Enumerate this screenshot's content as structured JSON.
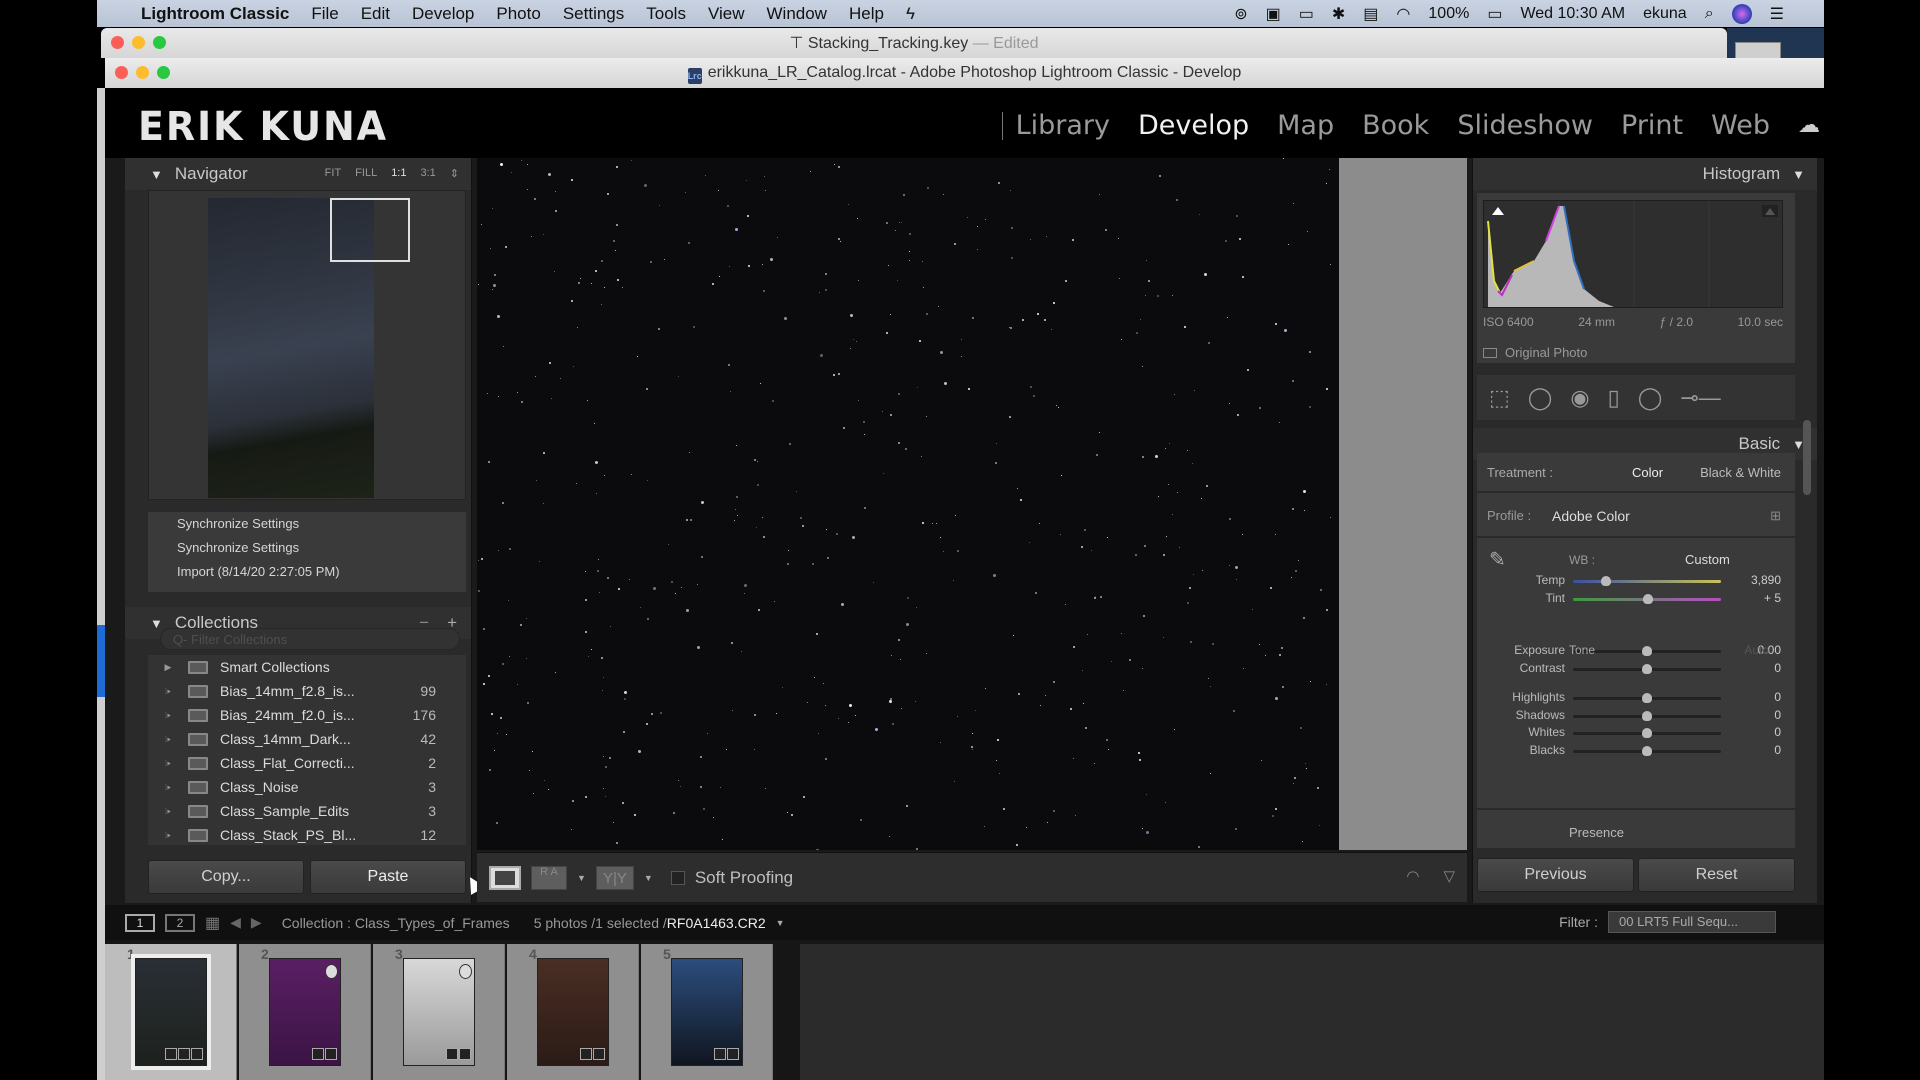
{
  "mac_menubar": {
    "app_name": "Lightroom Classic",
    "menus": [
      "File",
      "Edit",
      "Develop",
      "Photo",
      "Settings",
      "Tools",
      "View",
      "Window",
      "Help"
    ],
    "battery": "100%",
    "clock": "Wed 10:30 AM",
    "user": "ekuna"
  },
  "keynote_window": {
    "title": "Stacking_Tracking.key",
    "edited": "— Edited"
  },
  "lr_window": {
    "title": "erikkuna_LR_Catalog.lrcat - Adobe Photoshop Lightroom Classic - Develop",
    "icon_text": "Lrc"
  },
  "identity_plate": "ERIK KUNA",
  "modules": {
    "items": [
      "Library",
      "Develop",
      "Map",
      "Book",
      "Slideshow",
      "Print",
      "Web"
    ],
    "active": "Develop"
  },
  "navigator": {
    "title": "Navigator",
    "zoom_options": [
      "FIT",
      "FILL",
      "1:1",
      "3:1"
    ],
    "selected_zoom": "1:1"
  },
  "history": {
    "items": [
      "Synchronize Settings",
      "Synchronize Settings",
      "Import (8/14/20 2:27:05 PM)"
    ]
  },
  "collections": {
    "title": "Collections",
    "minus": "−",
    "plus": "+",
    "filter_placeholder": "Q- Filter Collections",
    "items": [
      {
        "name": "Smart Collections",
        "count": ""
      },
      {
        "name": "Bias_14mm_f2.8_is...",
        "count": "99"
      },
      {
        "name": "Bias_24mm_f2.0_is...",
        "count": "176"
      },
      {
        "name": "Class_14mm_Dark...",
        "count": "42"
      },
      {
        "name": "Class_Flat_Correcti...",
        "count": "2"
      },
      {
        "name": "Class_Noise",
        "count": "3"
      },
      {
        "name": "Class_Sample_Edits",
        "count": "3"
      },
      {
        "name": "Class_Stack_PS_Bl...",
        "count": "12"
      }
    ]
  },
  "left_buttons": {
    "copy": "Copy...",
    "paste": "Paste"
  },
  "toolbar": {
    "soft_proofing": "Soft Proofing",
    "before_after_label": "R A",
    "yy_label": "Y|Y"
  },
  "histogram": {
    "title": "Histogram",
    "iso": "ISO 6400",
    "focal": "24 mm",
    "aperture": "ƒ / 2.0",
    "shutter": "10.0 sec",
    "original_photo": "Original Photo"
  },
  "basic": {
    "title": "Basic",
    "treatment_label": "Treatment :",
    "treatment_options": [
      "Color",
      "Black & White"
    ],
    "treatment_selected": "Color",
    "profile_label": "Profile :",
    "profile_value": "Adobe Color",
    "wb_label": "WB :",
    "wb_value": "Custom",
    "temp": {
      "label": "Temp",
      "value": "3,890",
      "position": 0.22
    },
    "tint": {
      "label": "Tint",
      "value": "+ 5",
      "position": 0.51
    },
    "tone_label": "Tone",
    "auto_label": "Auto",
    "tone_sliders": [
      {
        "label": "Exposure",
        "value": "0.00",
        "position": 0.5
      },
      {
        "label": "Contrast",
        "value": "0",
        "position": 0.5
      },
      {
        "label": "Highlights",
        "value": "0",
        "position": 0.5
      },
      {
        "label": "Shadows",
        "value": "0",
        "position": 0.5
      },
      {
        "label": "Whites",
        "value": "0",
        "position": 0.5
      },
      {
        "label": "Blacks",
        "value": "0",
        "position": 0.5
      }
    ],
    "presence_label": "Presence"
  },
  "right_buttons": {
    "previous": "Previous",
    "reset": "Reset"
  },
  "filmstrip_bar": {
    "screen1": "1",
    "screen2": "2",
    "collection": "Collection : Class_Types_of_Frames",
    "count": "5 photos /1 selected /",
    "filename": "RF0A1463.CR2",
    "filter_label": "Filter :",
    "filter_value": "00 LRT5 Full Sequ..."
  },
  "filmstrip": {
    "frames": [
      {
        "num": "1",
        "colors": [
          "#2a2f36",
          "#1d211d"
        ],
        "selected": true
      },
      {
        "num": "2",
        "colors": [
          "#5a1f63",
          "#3b1445"
        ],
        "selected": false
      },
      {
        "num": "3",
        "colors": [
          "#d8d8d8",
          "#9a9a9a"
        ],
        "selected": false
      },
      {
        "num": "4",
        "colors": [
          "#4a2e24",
          "#2b1b16"
        ],
        "selected": false
      },
      {
        "num": "5",
        "colors": [
          "#2c4d7e",
          "#10161f"
        ],
        "selected": false
      }
    ]
  },
  "colors": {
    "accent_blue": "#1f6bd6",
    "panel_bg": "#2a2a2a",
    "photo_bg": "#0b0b0e"
  }
}
